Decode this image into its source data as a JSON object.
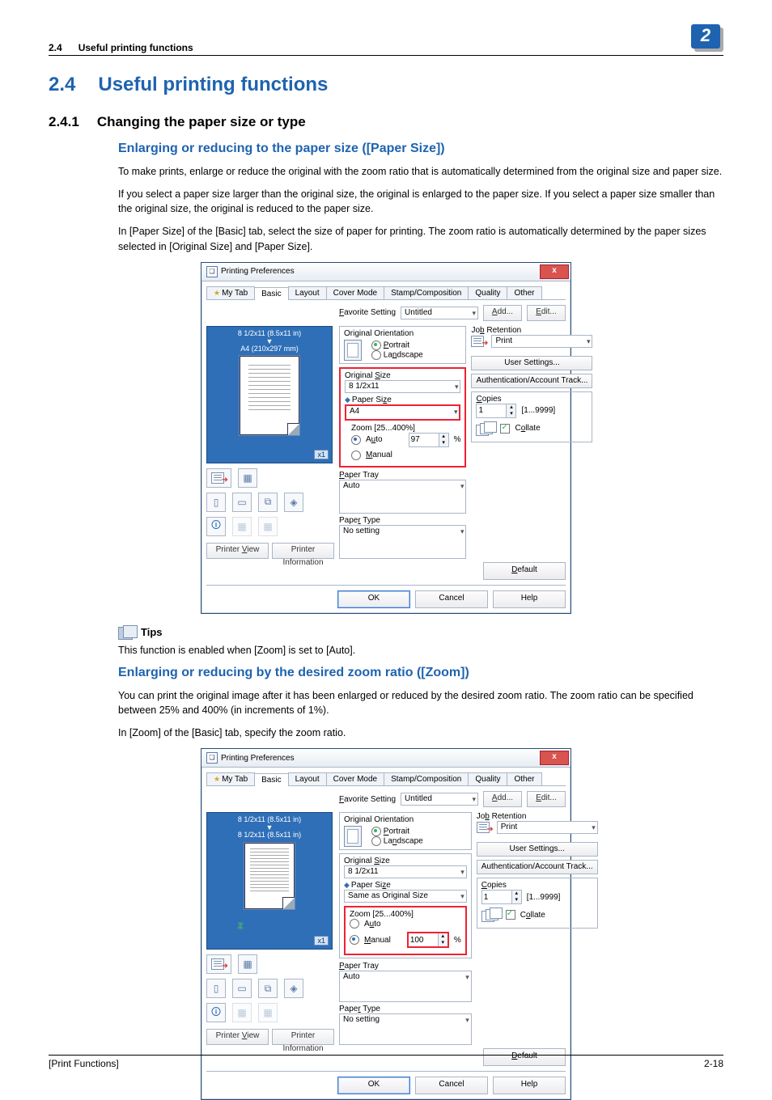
{
  "chapter_badge": "2",
  "header": {
    "section_num": "2.4",
    "section_title": "Useful printing functions"
  },
  "h_section": {
    "num": "2.4",
    "title": "Useful printing functions"
  },
  "h_sub": {
    "num": "2.4.1",
    "title": "Changing the paper size or type"
  },
  "topic1": {
    "title": "Enlarging or reducing to the paper size ([Paper Size])",
    "p1": "To make prints, enlarge or reduce the original with the zoom ratio that is automatically determined from the original size and paper size.",
    "p2": "If you select a paper size larger than the original size, the original is enlarged to the paper size. If you select a paper size smaller than the original size, the original is reduced to the paper size.",
    "p3": "In [Paper Size] of the [Basic] tab, select the size of paper for printing. The zoom ratio is automatically determined by the paper sizes selected in [Original Size] and [Paper Size]."
  },
  "tips": {
    "label": "Tips",
    "text": "This function is enabled when [Zoom] is set to [Auto]."
  },
  "topic2": {
    "title": "Enlarging or reducing by the desired zoom ratio ([Zoom])",
    "p1": "You can print the original image after it has been enlarged or reduced by the desired zoom ratio. The zoom ratio can be specified between 25% and 400% (in increments of 1%).",
    "p2": "In [Zoom] of the [Basic] tab, specify the zoom ratio."
  },
  "dialog": {
    "title": "Printing Preferences",
    "close": "x",
    "tabs": [
      "My Tab",
      "Basic",
      "Layout",
      "Cover Mode",
      "Stamp/Composition",
      "Quality",
      "Other"
    ],
    "favorite_label": "Favorite Setting",
    "favorite_value": "Untitled",
    "add_btn": "Add...",
    "edit_btn": "Edit...",
    "orient_label": "Original Orientation",
    "portrait": "Portrait",
    "landscape": "Landscape",
    "job_ret_label": "Job Retention",
    "job_ret_value": "Print",
    "origsize_label": "Original Size",
    "origsize_value": "8 1/2x11",
    "papersize_label": "Paper Size",
    "zoom_label": "Zoom [25...400%]",
    "auto": "Auto",
    "manual": "Manual",
    "pct": "%",
    "paper_tray_label": "Paper Tray",
    "paper_tray_value": "Auto",
    "paper_type_label": "Paper Type",
    "paper_type_value": "No setting",
    "user_settings": "User Settings...",
    "auth_track": "Authentication/Account Track...",
    "copies_label": "Copies",
    "copies_value": "1",
    "copies_range": "[1...9999]",
    "collate": "Collate",
    "printer_view": "Printer View",
    "printer_info": "Printer Information",
    "default": "Default",
    "ok": "OK",
    "cancel": "Cancel",
    "help": "Help"
  },
  "dlg1": {
    "preview_line1": "8 1/2x11 (8.5x11 in)",
    "preview_line2": "A4 (210x297 mm)",
    "papersize_value": "A4",
    "zoom_value": "97",
    "x1": "x1"
  },
  "dlg2": {
    "preview_line1": "8 1/2x11 (8.5x11 in)",
    "preview_line2": "8 1/2x11 (8.5x11 in)",
    "papersize_value": "Same as Original Size",
    "zoom_value": "100",
    "x1": "x1",
    "zoom_mark": "Z"
  },
  "footer": {
    "left": "[Print Functions]",
    "right": "2-18"
  }
}
